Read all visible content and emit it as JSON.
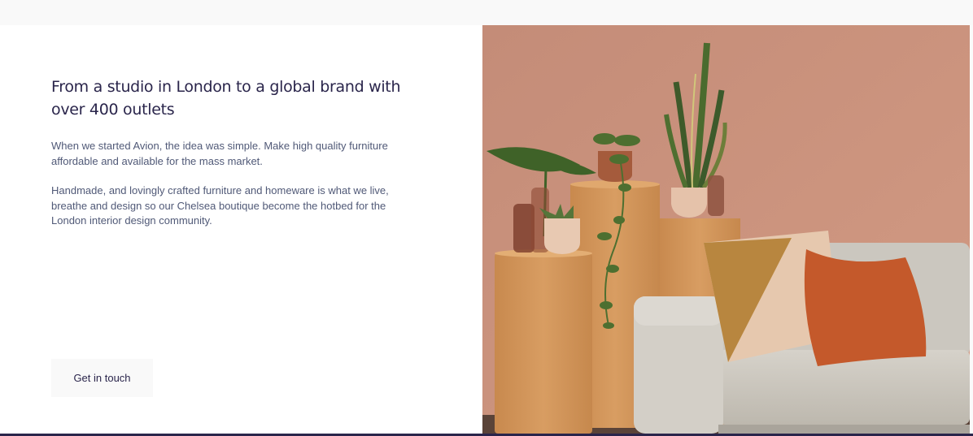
{
  "about": {
    "heading": "From a studio in London to a global brand with over 400 outlets",
    "paragraph_1": "When we started Avion, the idea was simple. Make high quality furniture affordable and available for the mass market.",
    "paragraph_2": "Handmade, and lovingly crafted furniture and homeware is what we live, breathe and design so our Chelsea boutique become the hotbed for the London interior design community.",
    "cta_label": "Get in touch"
  },
  "colors": {
    "brand_dark": "#2a254b",
    "body_text": "#505977",
    "light_surface": "#f9f9f9",
    "wall": "#c98f79",
    "cork": "#cf9558",
    "sofa": "#d1cdc5",
    "rust_cushion": "#c25a2c"
  },
  "image": {
    "subject": "photo-sofa-plants-cork-plinths"
  }
}
